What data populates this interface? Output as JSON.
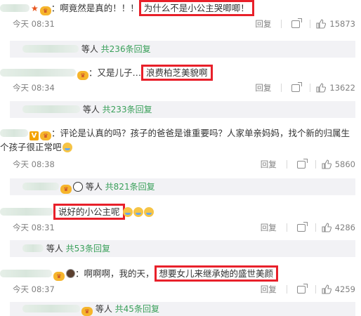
{
  "comments": [
    {
      "text": "：啊竟然是真的！！！",
      "highlight": "为什么不是小公主哭唧唧！",
      "time": "今天 08:31",
      "reply": "回复",
      "likes": "15873"
    },
    {
      "text": "：又是儿子…",
      "highlight": "浪费柏芝美貌啊",
      "time": "今天 08:34",
      "reply": "回复",
      "likes": "13622"
    },
    {
      "text": "：评论是认真的吗？孩子的爸爸是谁重要吗？人家单亲妈妈，找个新的归属生个孩子很正常吧",
      "time": "今天 08:38",
      "reply": "回复",
      "likes": "5860"
    },
    {
      "highlight": "说好的小公主呢",
      "time": "今天 08:31",
      "reply": "回复",
      "likes": "4286"
    },
    {
      "text": "：啊啊啊，我的天，",
      "highlight": "想要女儿来继承她的盛世美颜",
      "time": "今天 08:37",
      "reply": "回复",
      "likes": "4259"
    }
  ],
  "replies": [
    {
      "prefix": "等人",
      "link": "共236条回复"
    },
    {
      "prefix": "等人",
      "link": "共233条回复"
    },
    {
      "prefix": "等人",
      "link": "共821条回复"
    },
    {
      "prefix": "等人",
      "link": "共53条回复"
    },
    {
      "prefix": "等人",
      "link": "共45条回复"
    }
  ],
  "colors": {
    "highlight_box": "#e8202a",
    "reply_link": "#3aa05a",
    "meta_gray": "#808080",
    "reply_bar_bg": "#f2f2f5"
  },
  "icons": {
    "share": "share-icon",
    "like": "thumbs-up-icon",
    "emoji": "smile-emoji-icon",
    "badge": "user-badge-icon"
  }
}
